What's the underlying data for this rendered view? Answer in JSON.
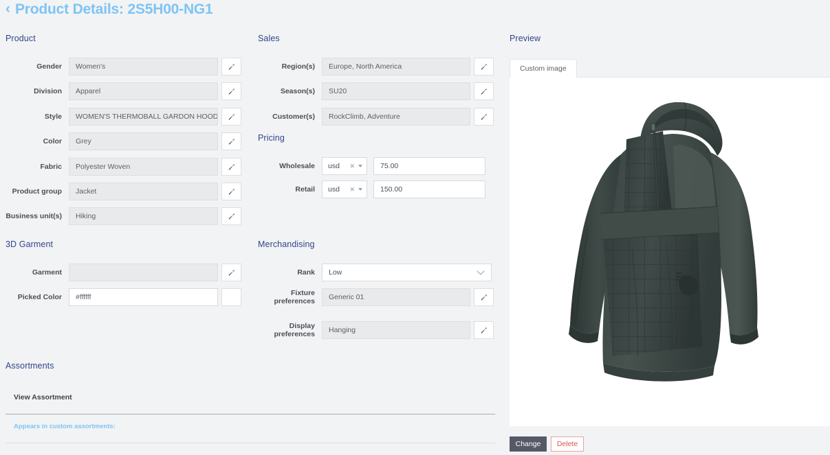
{
  "header": {
    "back_icon": "chevron-left-icon",
    "title": "Product Details: 2S5H00-NG1"
  },
  "sections": {
    "product": "Product",
    "garment3d": "3D Garment",
    "assortments": "Assortments",
    "sales": "Sales",
    "pricing": "Pricing",
    "merchandising": "Merchandising",
    "preview": "Preview"
  },
  "product_fields": [
    {
      "label": "Gender",
      "value": "Women's"
    },
    {
      "label": "Division",
      "value": "Apparel"
    },
    {
      "label": "Style",
      "value": "WOMEN'S THERMOBALL GARDON HOODIE"
    },
    {
      "label": "Color",
      "value": "Grey"
    },
    {
      "label": "Fabric",
      "value": "Polyester Woven"
    },
    {
      "label": "Product group",
      "value": "Jacket"
    },
    {
      "label": "Business unit(s)",
      "value": "Hiking"
    }
  ],
  "garment3d_fields": [
    {
      "label": "Garment",
      "value": ""
    },
    {
      "label": "Picked Color",
      "value": "#ffffff"
    }
  ],
  "assortments": {
    "view_link": "View Assortment",
    "appears_label": "Appears in custom assortments:"
  },
  "sales_fields": [
    {
      "label": "Region(s)",
      "value": "Europe, North America"
    },
    {
      "label": "Season(s)",
      "value": "SU20"
    },
    {
      "label": "Customer(s)",
      "value": "RockClimb, Adventure"
    }
  ],
  "pricing_fields": [
    {
      "label": "Wholesale",
      "currency": "usd",
      "amount": "75.00"
    },
    {
      "label": "Retail",
      "currency": "usd",
      "amount": "150.00"
    }
  ],
  "merchandising": {
    "rank": {
      "label": "Rank",
      "value": "Low"
    },
    "fixture": {
      "label": "Fixture preferences",
      "value": "Generic 01"
    },
    "display": {
      "label": "Display preferences",
      "value": "Hanging"
    }
  },
  "preview": {
    "tab_label": "Custom image",
    "image_alt": "grey quilted hooded jacket",
    "change_button": "Change",
    "delete_button": "Delete"
  },
  "colors": {
    "title_blue": "#7ec4f5",
    "section_blue": "#31458c",
    "page_bg": "#f2f3f4",
    "input_bg": "#e9eaeb",
    "change_btn": "#555a66",
    "delete_red": "#d9534f",
    "garment": "#3f4a48"
  }
}
